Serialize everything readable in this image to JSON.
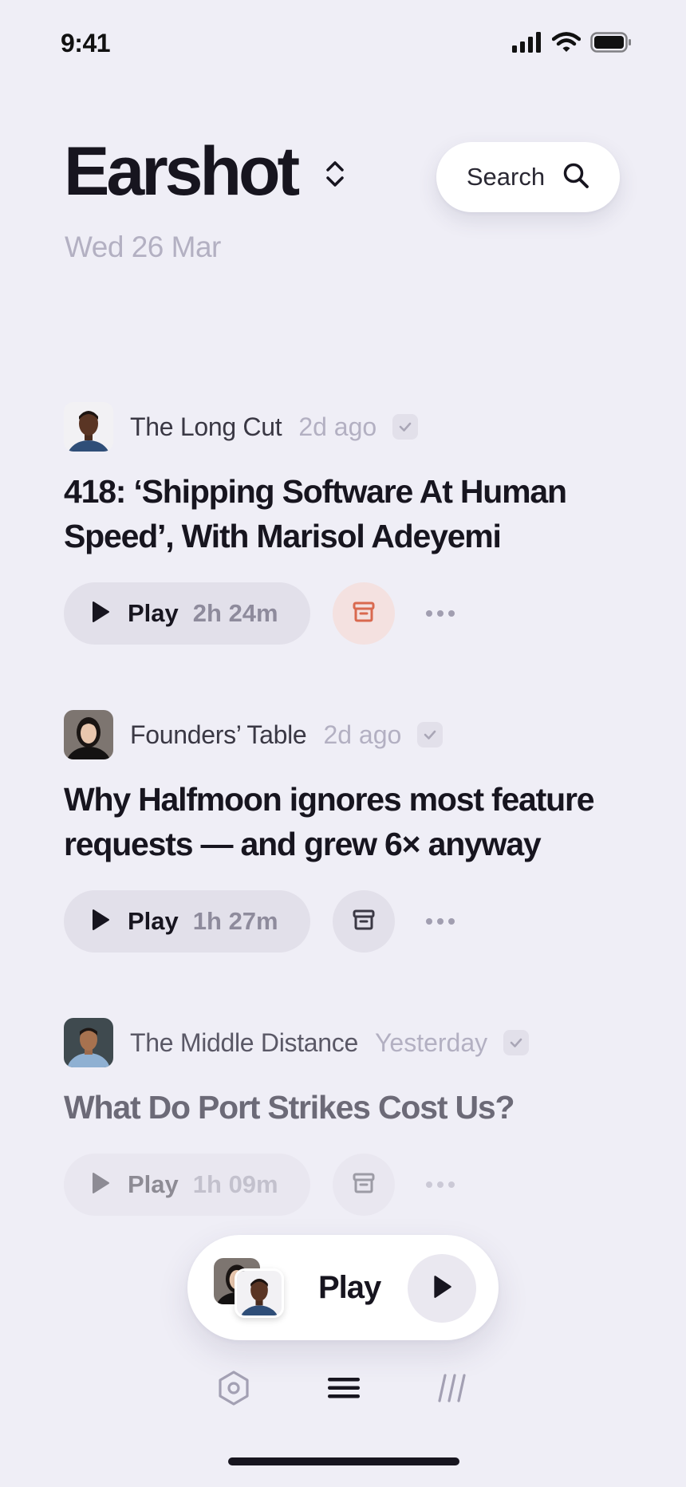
{
  "status_bar": {
    "time": "9:41"
  },
  "header": {
    "app_title": "Earshot",
    "date": "Wed 26 Mar",
    "search_label": "Search"
  },
  "feed": [
    {
      "show": "The Long Cut",
      "ago": "2d ago",
      "title": "418: ‘Shipping Software At Human Speed’, With Marisol Adeyemi",
      "play_label": "Play",
      "duration": "2h 24m",
      "archive_active": true
    },
    {
      "show": "Founders’ Table",
      "ago": "2d ago",
      "title": "Why Halfmoon ignores most feature requests — and grew 6× anyway",
      "play_label": "Play",
      "duration": "1h 27m",
      "archive_active": false
    },
    {
      "show": "The Middle Distance",
      "ago": "Yesterday",
      "title": "What Do Port Strikes Cost Us?",
      "play_label": "Play",
      "duration": "1h 09m",
      "archive_active": false
    }
  ],
  "now_playing": {
    "label": "Play"
  },
  "colors": {
    "background": "#efeef6",
    "text": "#17151f",
    "muted": "#b3b0c2",
    "archive_accent": "#d9694f"
  },
  "icons": {
    "status": [
      "signal-icon",
      "wifi-icon",
      "battery-icon"
    ],
    "tabs": [
      "hexagon-icon",
      "menu-icon",
      "library-icon"
    ]
  }
}
